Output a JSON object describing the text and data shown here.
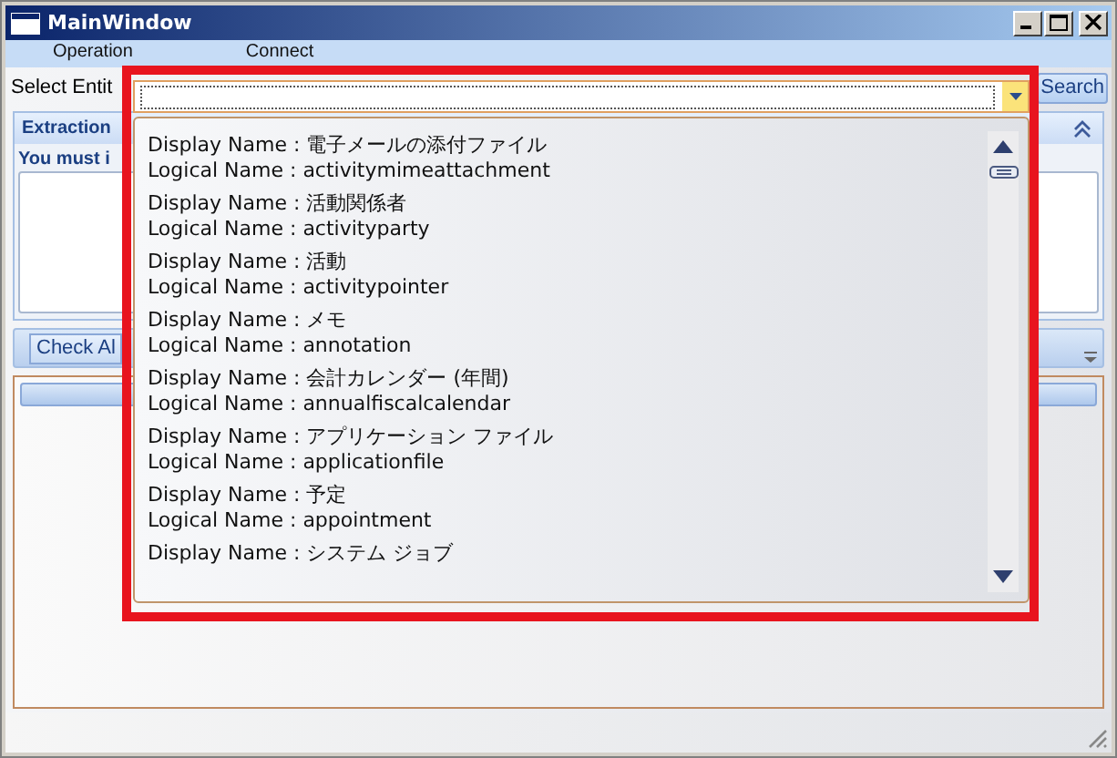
{
  "window": {
    "title": "MainWindow"
  },
  "menu": [
    {
      "label": "Operation"
    },
    {
      "label": "Connect"
    }
  ],
  "entity_row": {
    "label": "Select Entit",
    "button": "Search"
  },
  "extraction_panel": {
    "title": "Extraction",
    "message": "You must i"
  },
  "toolbar": {
    "button": "Check Al"
  },
  "entity_dropdown": {
    "items": [
      {
        "display": "Display Name : 電子メールの添付ファイル",
        "logical": "Logical Name : activitymimeattachment"
      },
      {
        "display": "Display Name : 活動関係者",
        "logical": "Logical Name : activityparty"
      },
      {
        "display": "Display Name : 活動",
        "logical": "Logical Name : activitypointer"
      },
      {
        "display": "Display Name : メモ",
        "logical": "Logical Name : annotation"
      },
      {
        "display": "Display Name : 会計カレンダー (年間)",
        "logical": "Logical Name : annualfiscalcalendar"
      },
      {
        "display": "Display Name : アプリケーション ファイル",
        "logical": "Logical Name : applicationfile"
      },
      {
        "display": "Display Name : 予定",
        "logical": "Logical Name : appointment"
      },
      {
        "display": "Display Name : システム ジョブ"
      }
    ]
  }
}
